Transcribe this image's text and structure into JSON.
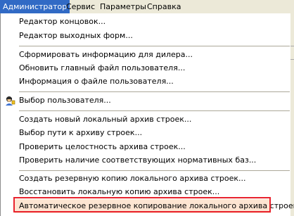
{
  "menubar": {
    "items": [
      {
        "label": "Администратор"
      },
      {
        "label": "Сервис"
      },
      {
        "label": "Параметры"
      },
      {
        "label": "Справка"
      }
    ]
  },
  "dropdown": {
    "items": [
      {
        "label": "Редактор концовок..."
      },
      {
        "label": "Редактор выходных форм..."
      },
      {
        "label": "Сформировать информацию для дилера..."
      },
      {
        "label": "Обновить главный файл пользователя..."
      },
      {
        "label": "Информация о файле пользователя..."
      },
      {
        "label": "Выбор пользователя...",
        "icon": "user-icon"
      },
      {
        "label": "Создать новый локальный архив строек..."
      },
      {
        "label": "Выбор пути к архиву строек..."
      },
      {
        "label": "Проверить целостность архива строек..."
      },
      {
        "label": "Проверить наличие соответствующих нормативных баз..."
      },
      {
        "label": "Создать резервную копию локального архива строек..."
      },
      {
        "label": "Восстановить локальную копию архива строек..."
      },
      {
        "label": "Автоматическое резервное копирование локального архива строек..."
      }
    ]
  },
  "colors": {
    "menubar_bg": "#ece9d8",
    "active_menu_bg": "#316ac5",
    "highlight_border": "#e8232e",
    "selected_bg": "#fde5d2"
  }
}
